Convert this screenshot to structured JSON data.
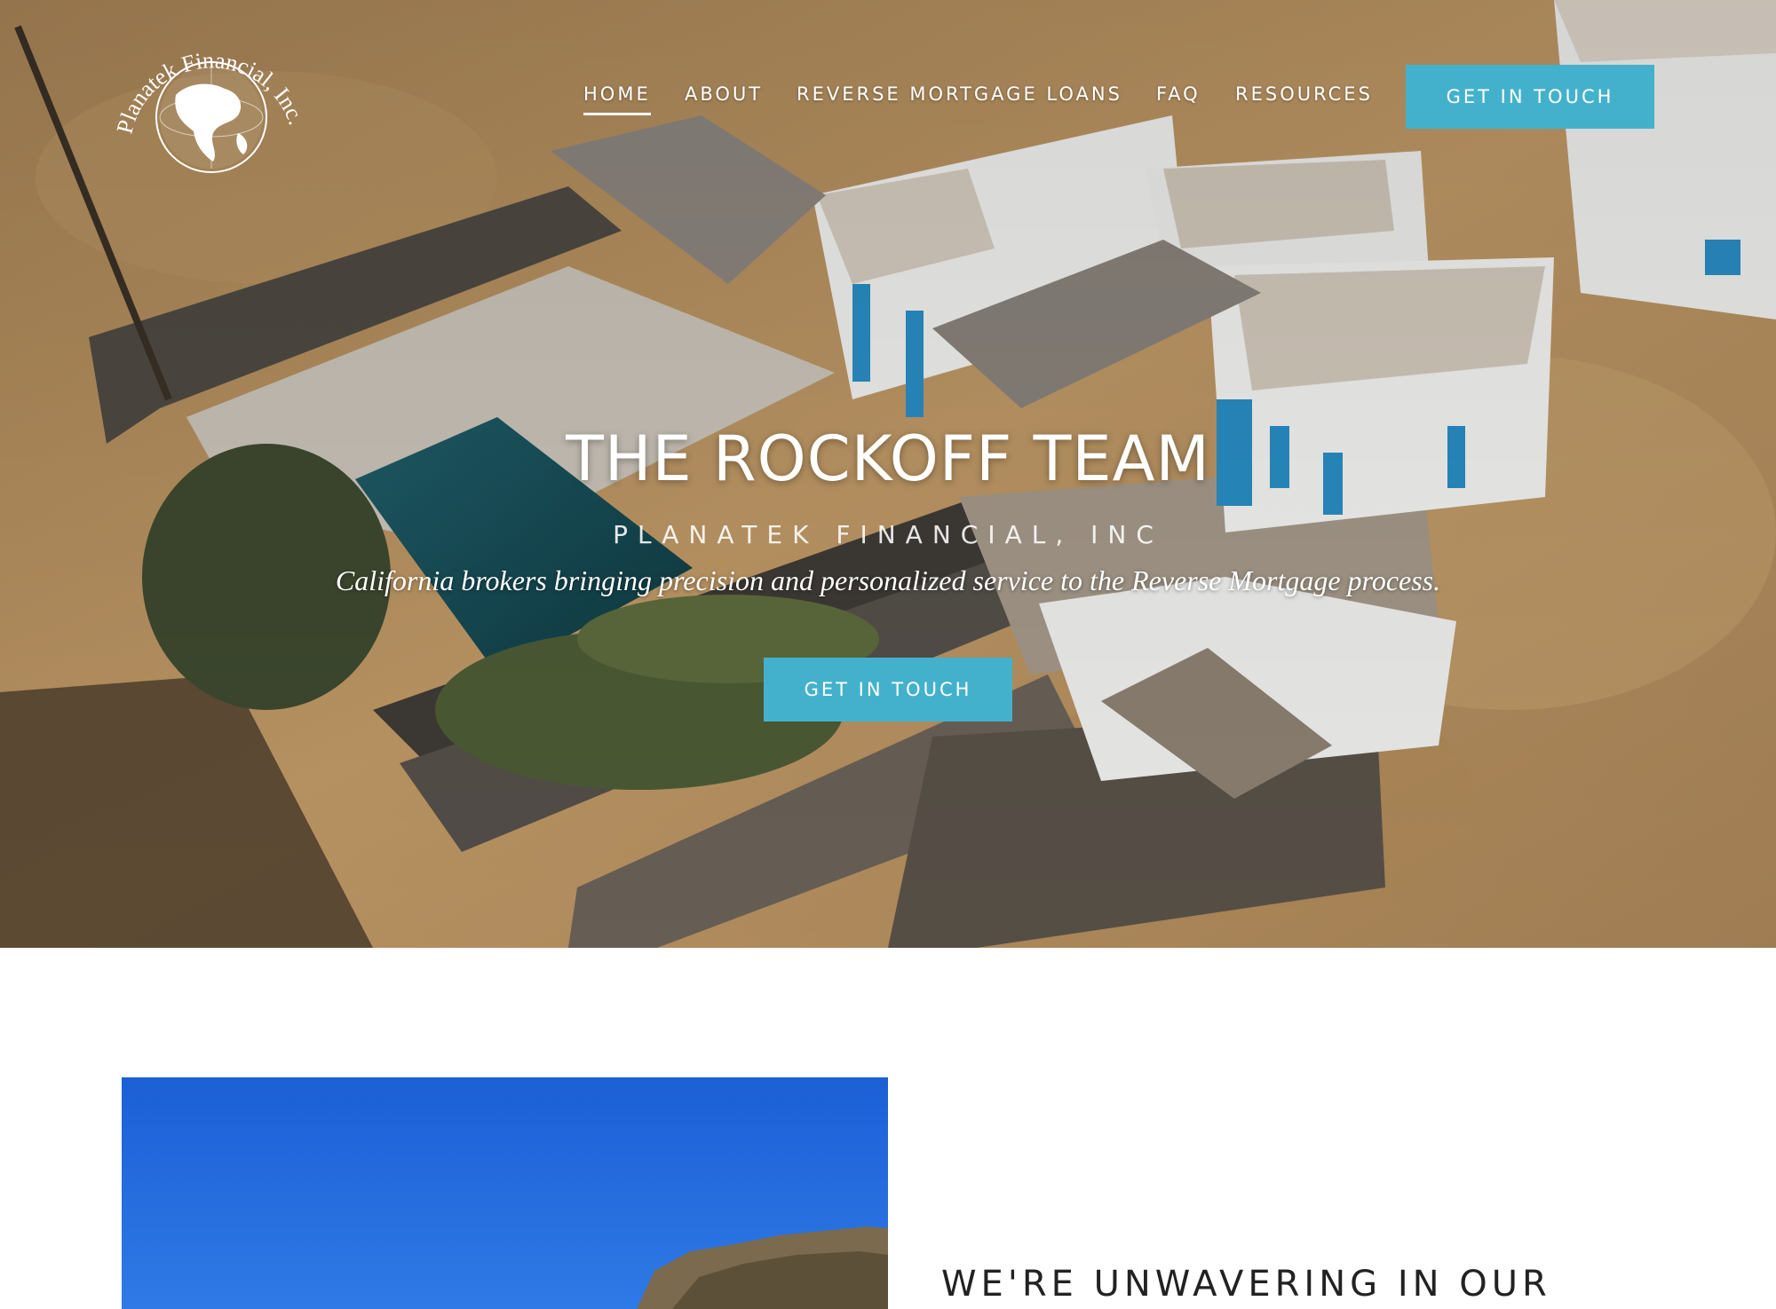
{
  "header": {
    "logo_text": "Planatek Financial, Inc.",
    "nav": [
      {
        "label": "HOME",
        "active": true
      },
      {
        "label": "ABOUT",
        "active": false
      },
      {
        "label": "REVERSE MORTGAGE LOANS",
        "active": false
      },
      {
        "label": "FAQ",
        "active": false
      },
      {
        "label": "RESOURCES",
        "active": false
      }
    ],
    "cta_label": "GET IN TOUCH"
  },
  "hero": {
    "title": "THE ROCKOFF TEAM",
    "subtitle": "PLANATEK FINANCIAL, INC",
    "tagline": "California brokers bringing precision and personalized service to the Reverse Mortgage process.",
    "cta_label": "GET IN TOUCH"
  },
  "about": {
    "heading": "WE'RE UNWAVERING IN OUR"
  },
  "colors": {
    "accent": "#44b1cc",
    "text_dark": "#222222"
  }
}
